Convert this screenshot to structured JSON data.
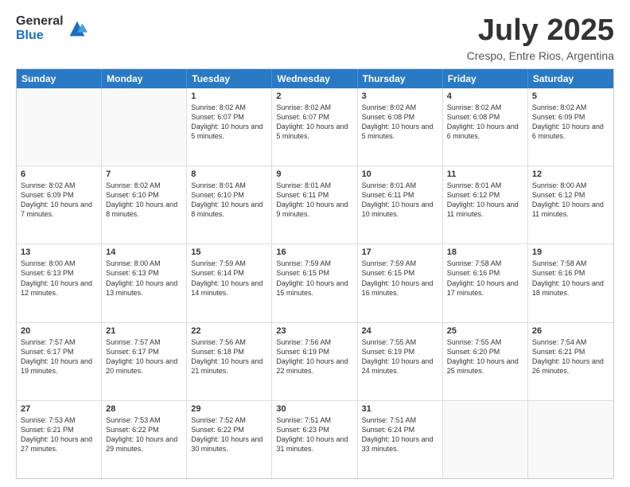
{
  "logo": {
    "general": "General",
    "blue": "Blue"
  },
  "title": "July 2025",
  "location": "Crespo, Entre Rios, Argentina",
  "days_of_week": [
    "Sunday",
    "Monday",
    "Tuesday",
    "Wednesday",
    "Thursday",
    "Friday",
    "Saturday"
  ],
  "weeks": [
    [
      {
        "day": "",
        "info": ""
      },
      {
        "day": "",
        "info": ""
      },
      {
        "day": "1",
        "info": "Sunrise: 8:02 AM\nSunset: 6:07 PM\nDaylight: 10 hours and 5 minutes."
      },
      {
        "day": "2",
        "info": "Sunrise: 8:02 AM\nSunset: 6:07 PM\nDaylight: 10 hours and 5 minutes."
      },
      {
        "day": "3",
        "info": "Sunrise: 8:02 AM\nSunset: 6:08 PM\nDaylight: 10 hours and 5 minutes."
      },
      {
        "day": "4",
        "info": "Sunrise: 8:02 AM\nSunset: 6:08 PM\nDaylight: 10 hours and 6 minutes."
      },
      {
        "day": "5",
        "info": "Sunrise: 8:02 AM\nSunset: 6:09 PM\nDaylight: 10 hours and 6 minutes."
      }
    ],
    [
      {
        "day": "6",
        "info": "Sunrise: 8:02 AM\nSunset: 6:09 PM\nDaylight: 10 hours and 7 minutes."
      },
      {
        "day": "7",
        "info": "Sunrise: 8:02 AM\nSunset: 6:10 PM\nDaylight: 10 hours and 8 minutes."
      },
      {
        "day": "8",
        "info": "Sunrise: 8:01 AM\nSunset: 6:10 PM\nDaylight: 10 hours and 8 minutes."
      },
      {
        "day": "9",
        "info": "Sunrise: 8:01 AM\nSunset: 6:11 PM\nDaylight: 10 hours and 9 minutes."
      },
      {
        "day": "10",
        "info": "Sunrise: 8:01 AM\nSunset: 6:11 PM\nDaylight: 10 hours and 10 minutes."
      },
      {
        "day": "11",
        "info": "Sunrise: 8:01 AM\nSunset: 6:12 PM\nDaylight: 10 hours and 11 minutes."
      },
      {
        "day": "12",
        "info": "Sunrise: 8:00 AM\nSunset: 6:12 PM\nDaylight: 10 hours and 11 minutes."
      }
    ],
    [
      {
        "day": "13",
        "info": "Sunrise: 8:00 AM\nSunset: 6:13 PM\nDaylight: 10 hours and 12 minutes."
      },
      {
        "day": "14",
        "info": "Sunrise: 8:00 AM\nSunset: 6:13 PM\nDaylight: 10 hours and 13 minutes."
      },
      {
        "day": "15",
        "info": "Sunrise: 7:59 AM\nSunset: 6:14 PM\nDaylight: 10 hours and 14 minutes."
      },
      {
        "day": "16",
        "info": "Sunrise: 7:59 AM\nSunset: 6:15 PM\nDaylight: 10 hours and 15 minutes."
      },
      {
        "day": "17",
        "info": "Sunrise: 7:59 AM\nSunset: 6:15 PM\nDaylight: 10 hours and 16 minutes."
      },
      {
        "day": "18",
        "info": "Sunrise: 7:58 AM\nSunset: 6:16 PM\nDaylight: 10 hours and 17 minutes."
      },
      {
        "day": "19",
        "info": "Sunrise: 7:58 AM\nSunset: 6:16 PM\nDaylight: 10 hours and 18 minutes."
      }
    ],
    [
      {
        "day": "20",
        "info": "Sunrise: 7:57 AM\nSunset: 6:17 PM\nDaylight: 10 hours and 19 minutes."
      },
      {
        "day": "21",
        "info": "Sunrise: 7:57 AM\nSunset: 6:17 PM\nDaylight: 10 hours and 20 minutes."
      },
      {
        "day": "22",
        "info": "Sunrise: 7:56 AM\nSunset: 6:18 PM\nDaylight: 10 hours and 21 minutes."
      },
      {
        "day": "23",
        "info": "Sunrise: 7:56 AM\nSunset: 6:19 PM\nDaylight: 10 hours and 22 minutes."
      },
      {
        "day": "24",
        "info": "Sunrise: 7:55 AM\nSunset: 6:19 PM\nDaylight: 10 hours and 24 minutes."
      },
      {
        "day": "25",
        "info": "Sunrise: 7:55 AM\nSunset: 6:20 PM\nDaylight: 10 hours and 25 minutes."
      },
      {
        "day": "26",
        "info": "Sunrise: 7:54 AM\nSunset: 6:21 PM\nDaylight: 10 hours and 26 minutes."
      }
    ],
    [
      {
        "day": "27",
        "info": "Sunrise: 7:53 AM\nSunset: 6:21 PM\nDaylight: 10 hours and 27 minutes."
      },
      {
        "day": "28",
        "info": "Sunrise: 7:53 AM\nSunset: 6:22 PM\nDaylight: 10 hours and 29 minutes."
      },
      {
        "day": "29",
        "info": "Sunrise: 7:52 AM\nSunset: 6:22 PM\nDaylight: 10 hours and 30 minutes."
      },
      {
        "day": "30",
        "info": "Sunrise: 7:51 AM\nSunset: 6:23 PM\nDaylight: 10 hours and 31 minutes."
      },
      {
        "day": "31",
        "info": "Sunrise: 7:51 AM\nSunset: 6:24 PM\nDaylight: 10 hours and 33 minutes."
      },
      {
        "day": "",
        "info": ""
      },
      {
        "day": "",
        "info": ""
      }
    ]
  ]
}
